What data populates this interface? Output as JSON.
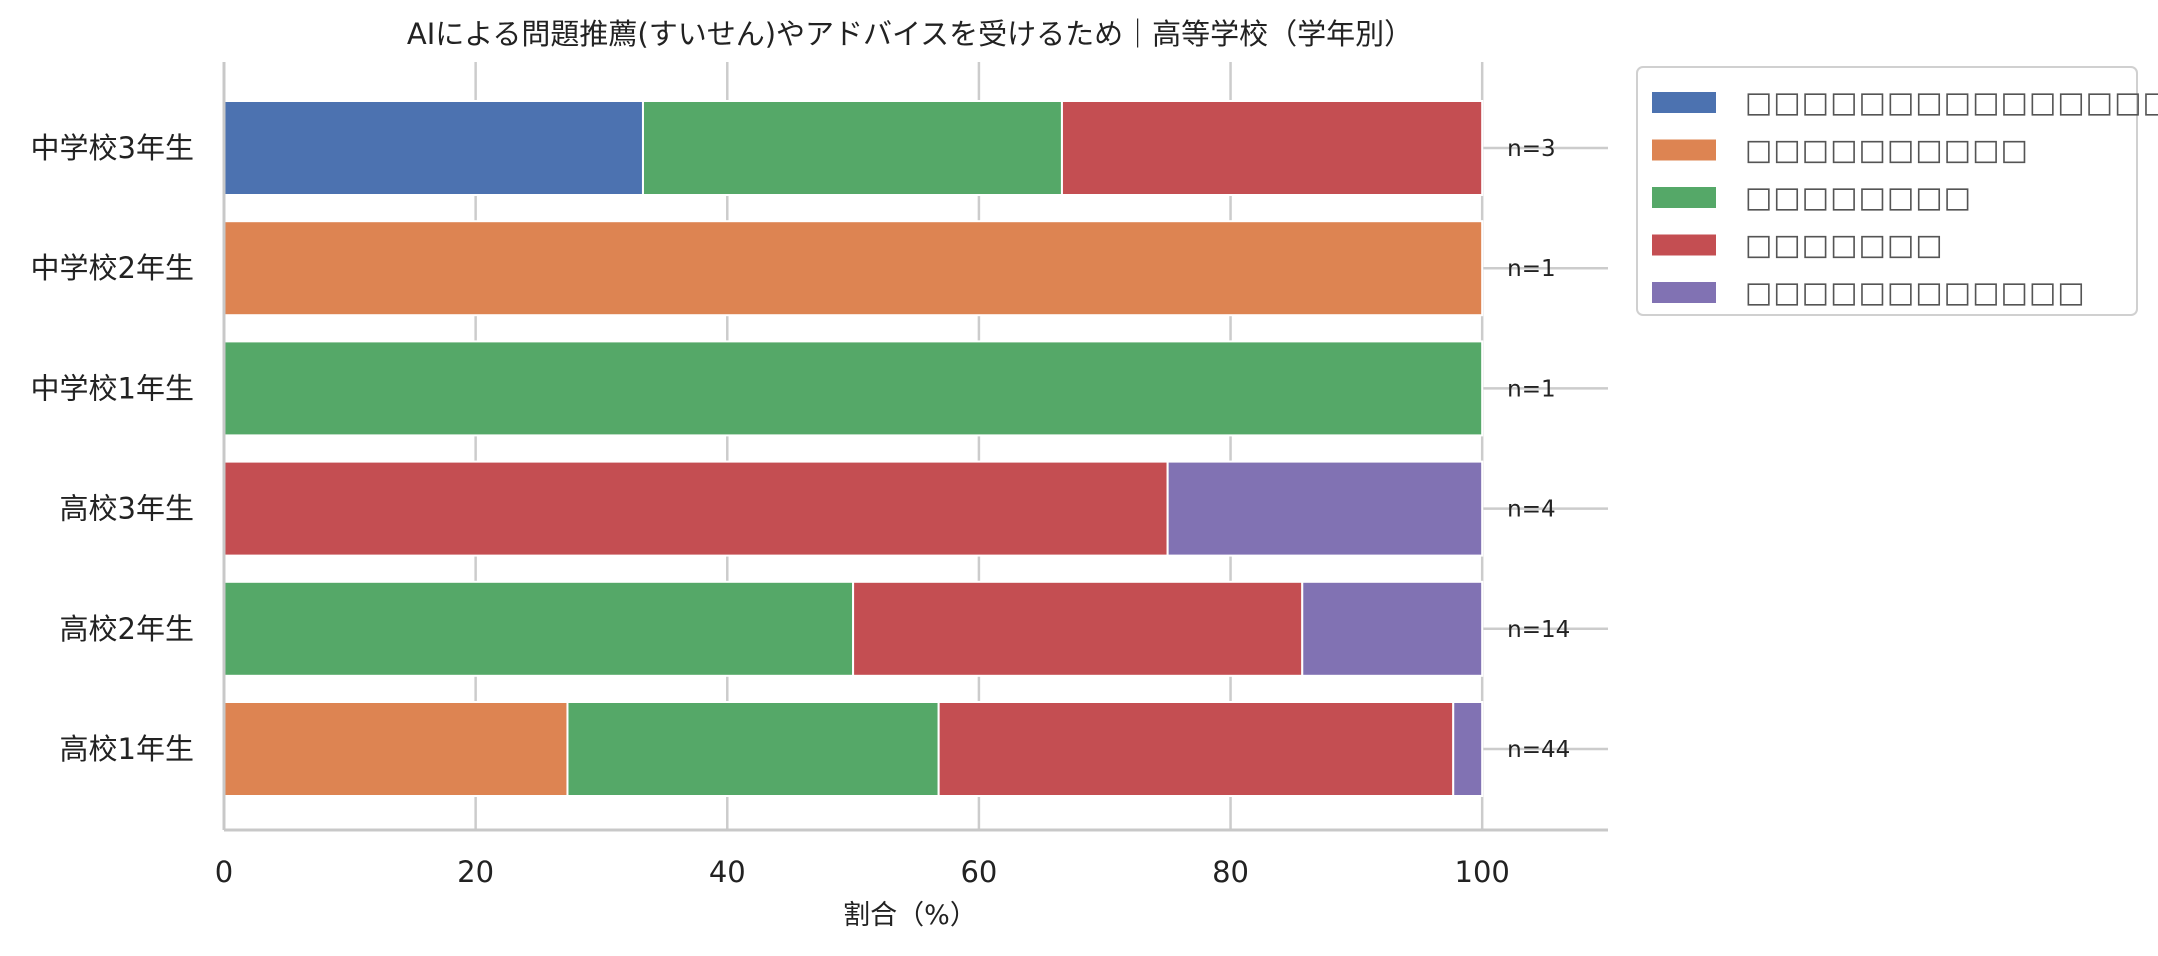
{
  "chart_data": {
    "type": "bar",
    "orientation": "horizontal",
    "stacked": true,
    "title": "AIによる問題推薦(すいせん)やアドバイスを受けるため｜高等学校（学年別）",
    "xlabel": "割合（%）",
    "ylabel": "",
    "xlim": [
      0,
      110
    ],
    "xticks": [
      0,
      20,
      40,
      60,
      80,
      100
    ],
    "grid": true,
    "legend_position": "outside-right-top",
    "categories": [
      "中学校3年生",
      "中学校2年生",
      "中学校1年生",
      "高校3年生",
      "高校2年生",
      "高校1年生"
    ],
    "n_labels": [
      "n=3",
      "n=1",
      "n=1",
      "n=4",
      "n=14",
      "n=44"
    ],
    "series": [
      {
        "name": "□□□□□□□□□□□□□□□□□",
        "color": "#4c72b0",
        "values": [
          33.3,
          0,
          0,
          0,
          0,
          0
        ]
      },
      {
        "name": "□□□□□□□□□□",
        "color": "#dd8452",
        "values": [
          0,
          100,
          0,
          0,
          0,
          27.3
        ]
      },
      {
        "name": "□□□□□□□□",
        "color": "#55a868",
        "values": [
          33.3,
          0,
          100,
          0,
          50.0,
          29.5
        ]
      },
      {
        "name": "□□□□□□□",
        "color": "#c44e52",
        "values": [
          33.4,
          0,
          0,
          75.0,
          35.7,
          40.9
        ]
      },
      {
        "name": "□□□□□□□□□□□□",
        "color": "#8172b3",
        "values": [
          0,
          0,
          0,
          25.0,
          14.3,
          2.3
        ]
      }
    ]
  }
}
